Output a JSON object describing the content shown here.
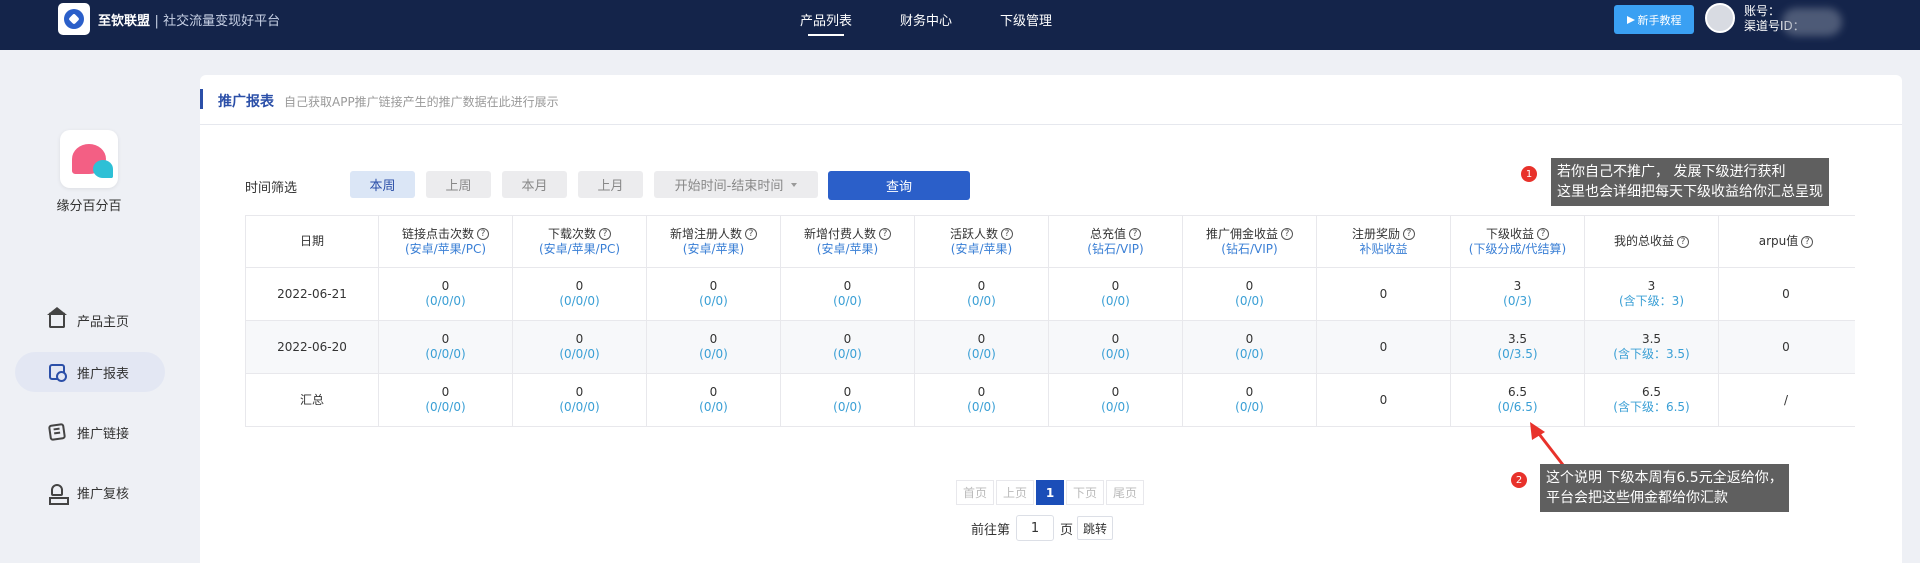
{
  "topbar": {
    "brand": "至钦联盟",
    "slogan": "社交流量变现好平台",
    "nav": [
      "产品列表",
      "财务中心",
      "下级管理"
    ],
    "guide_button": "新手教程",
    "account_label": "账号：",
    "channel_label": "渠道号ID："
  },
  "sidebar": {
    "app_name": "缘分百分百",
    "items": [
      {
        "label": "产品主页",
        "icon": "home-icon"
      },
      {
        "label": "推广报表",
        "icon": "report-icon"
      },
      {
        "label": "推广链接",
        "icon": "link-icon"
      },
      {
        "label": "推广复核",
        "icon": "review-icon"
      }
    ]
  },
  "header": {
    "title": "推广报表",
    "description": "自己获取APP推广链接产生的推广数据在此进行展示"
  },
  "filter": {
    "label": "时间筛选",
    "buttons": [
      "本周",
      "上周",
      "本月",
      "上月"
    ],
    "range_placeholder": "开始时间-结束时间",
    "query_button": "查询"
  },
  "table": {
    "columns": [
      {
        "title": "日期",
        "sub": "",
        "help": false
      },
      {
        "title": "链接点击次数",
        "sub": "(安卓/苹果/PC)",
        "help": true
      },
      {
        "title": "下载次数",
        "sub": "(安卓/苹果/PC)",
        "help": true
      },
      {
        "title": "新增注册人数",
        "sub": "(安卓/苹果)",
        "help": true
      },
      {
        "title": "新增付费人数",
        "sub": "(安卓/苹果)",
        "help": true
      },
      {
        "title": "活跃人数",
        "sub": "(安卓/苹果)",
        "help": true
      },
      {
        "title": "总充值",
        "sub": "(钻石/VIP)",
        "help": true
      },
      {
        "title": "推广佣金收益",
        "sub": "(钻石/VIP)",
        "help": true
      },
      {
        "title": "注册奖励",
        "sub": "补贴收益",
        "help": true
      },
      {
        "title": "下级收益",
        "sub": "(下级分成/代结算)",
        "help": true
      },
      {
        "title": "我的总收益",
        "sub": "",
        "help": true
      },
      {
        "title": "arpu值",
        "sub": "",
        "help": true
      }
    ],
    "rows": [
      [
        {
          "v": "2022-06-21",
          "s": ""
        },
        {
          "v": "0",
          "s": "(0/0/0)"
        },
        {
          "v": "0",
          "s": "(0/0/0)"
        },
        {
          "v": "0",
          "s": "(0/0)"
        },
        {
          "v": "0",
          "s": "(0/0)"
        },
        {
          "v": "0",
          "s": "(0/0)"
        },
        {
          "v": "0",
          "s": "(0/0)"
        },
        {
          "v": "0",
          "s": "(0/0)"
        },
        {
          "v": "0",
          "s": ""
        },
        {
          "v": "3",
          "s": "(0/3)"
        },
        {
          "v": "3",
          "s": "(含下级：3)"
        },
        {
          "v": "0",
          "s": ""
        }
      ],
      [
        {
          "v": "2022-06-20",
          "s": ""
        },
        {
          "v": "0",
          "s": "(0/0/0)"
        },
        {
          "v": "0",
          "s": "(0/0/0)"
        },
        {
          "v": "0",
          "s": "(0/0)"
        },
        {
          "v": "0",
          "s": "(0/0)"
        },
        {
          "v": "0",
          "s": "(0/0)"
        },
        {
          "v": "0",
          "s": "(0/0)"
        },
        {
          "v": "0",
          "s": "(0/0)"
        },
        {
          "v": "0",
          "s": ""
        },
        {
          "v": "3.5",
          "s": "(0/3.5)"
        },
        {
          "v": "3.5",
          "s": "(含下级：3.5)"
        },
        {
          "v": "0",
          "s": ""
        }
      ],
      [
        {
          "v": "汇总",
          "s": ""
        },
        {
          "v": "0",
          "s": "(0/0/0)"
        },
        {
          "v": "0",
          "s": "(0/0/0)"
        },
        {
          "v": "0",
          "s": "(0/0)"
        },
        {
          "v": "0",
          "s": "(0/0)"
        },
        {
          "v": "0",
          "s": "(0/0)"
        },
        {
          "v": "0",
          "s": "(0/0)"
        },
        {
          "v": "0",
          "s": "(0/0)"
        },
        {
          "v": "0",
          "s": ""
        },
        {
          "v": "6.5",
          "s": "(0/6.5)"
        },
        {
          "v": "6.5",
          "s": "(含下级：6.5)"
        },
        {
          "v": "/",
          "s": ""
        }
      ]
    ]
  },
  "pagination": {
    "first": "首页",
    "prev": "上页",
    "current": "1",
    "next": "下页",
    "last": "尾页",
    "goto_prefix": "前往第",
    "goto_value": "1",
    "goto_suffix": "页",
    "goto_button": "跳转"
  },
  "annotations": [
    {
      "num": "1",
      "lines": [
        "若你自己不推广， 发展下级进行获利",
        "这里也会详细把每天下级收益给你汇总呈现"
      ]
    },
    {
      "num": "2",
      "lines": [
        "这个说明 下级本周有6.5元全返给你，",
        "平台会把这些佣金都给你汇款"
      ]
    }
  ],
  "colors": {
    "topbar": "#14244a",
    "accent": "#2b4fa8",
    "query_button": "#2b5fc9",
    "annotation_badge": "#e8322b"
  }
}
